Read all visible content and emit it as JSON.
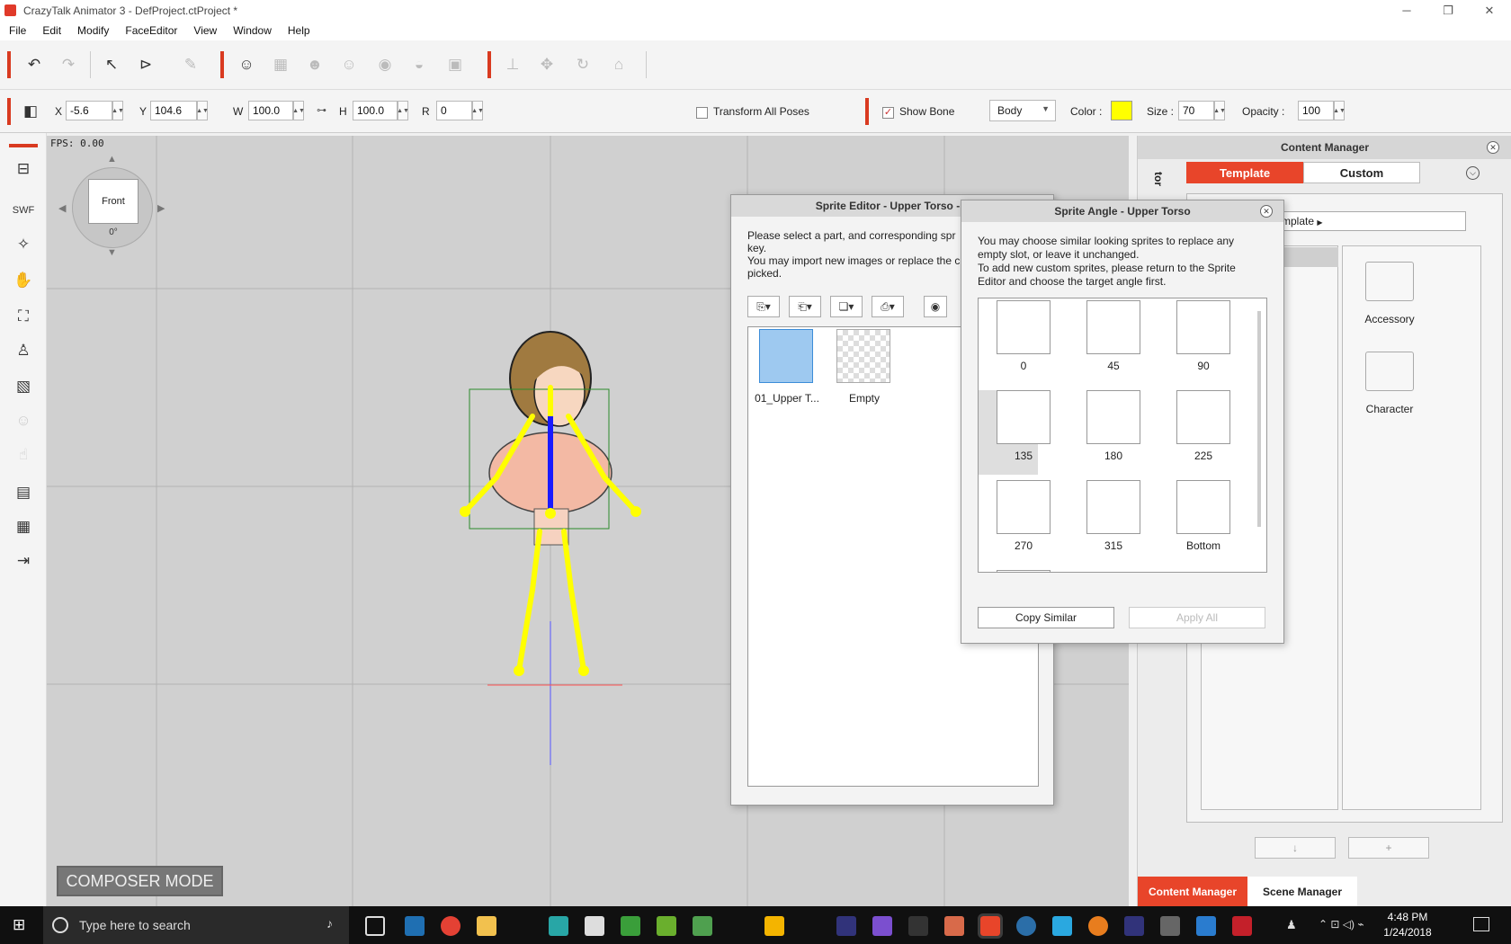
{
  "window": {
    "title": "CrazyTalk Animator 3 - DefProject.ctProject *"
  },
  "menu": [
    "File",
    "Edit",
    "Modify",
    "FaceEditor",
    "View",
    "Window",
    "Help"
  ],
  "transform": {
    "x_label": "X",
    "x": "-5.6",
    "y_label": "Y",
    "y": "104.6",
    "w_label": "W",
    "w": "100.0",
    "h_label": "H",
    "h": "100.0",
    "r_label": "R",
    "r": "0",
    "transform_all_label": "Transform All Poses",
    "show_bone_label": "Show Bone",
    "body_select": "Body",
    "color_label": "Color :",
    "color_value": "#ffff00",
    "size_label": "Size :",
    "size": "70",
    "opacity_label": "Opacity :",
    "opacity": "100"
  },
  "viewport": {
    "fps": "FPS: 0.00",
    "view_label": "Front",
    "view_angle": "0°",
    "mode": "COMPOSER MODE"
  },
  "sprite_editor": {
    "title": "Sprite Editor - Upper Torso - 0",
    "line1": "Please select a part, and corresponding spr",
    "line2": "key.",
    "line3": "You may import new images or replace the c",
    "line4": "picked.",
    "items": [
      {
        "label": "01_Upper T..."
      },
      {
        "label": "Empty"
      }
    ]
  },
  "sprite_angle": {
    "title": "Sprite Angle - Upper Torso",
    "line1": "You may choose similar looking sprites to replace any",
    "line2": "empty slot, or leave it unchanged.",
    "line3": "To add new custom sprites, please return to the Sprite",
    "line4": "Editor and choose the target angle first.",
    "angles": [
      "0",
      "45",
      "90",
      "135",
      "180",
      "225",
      "270",
      "315",
      "Bottom"
    ],
    "copy_similar": "Copy Similar",
    "apply_all": "Apply All"
  },
  "content_manager": {
    "title": "Content Manager",
    "tab_template": "Template",
    "tab_custom": "Custom",
    "side_label": "tor",
    "breadcrumb": "mplate",
    "selected_item": "e",
    "folders": [
      "Accessory",
      "Character"
    ]
  },
  "bottom_tabs": {
    "content_manager": "Content Manager",
    "scene_manager": "Scene Manager"
  },
  "taskbar": {
    "search_placeholder": "Type here to search",
    "time": "4:48 PM",
    "date": "1/24/2018"
  }
}
